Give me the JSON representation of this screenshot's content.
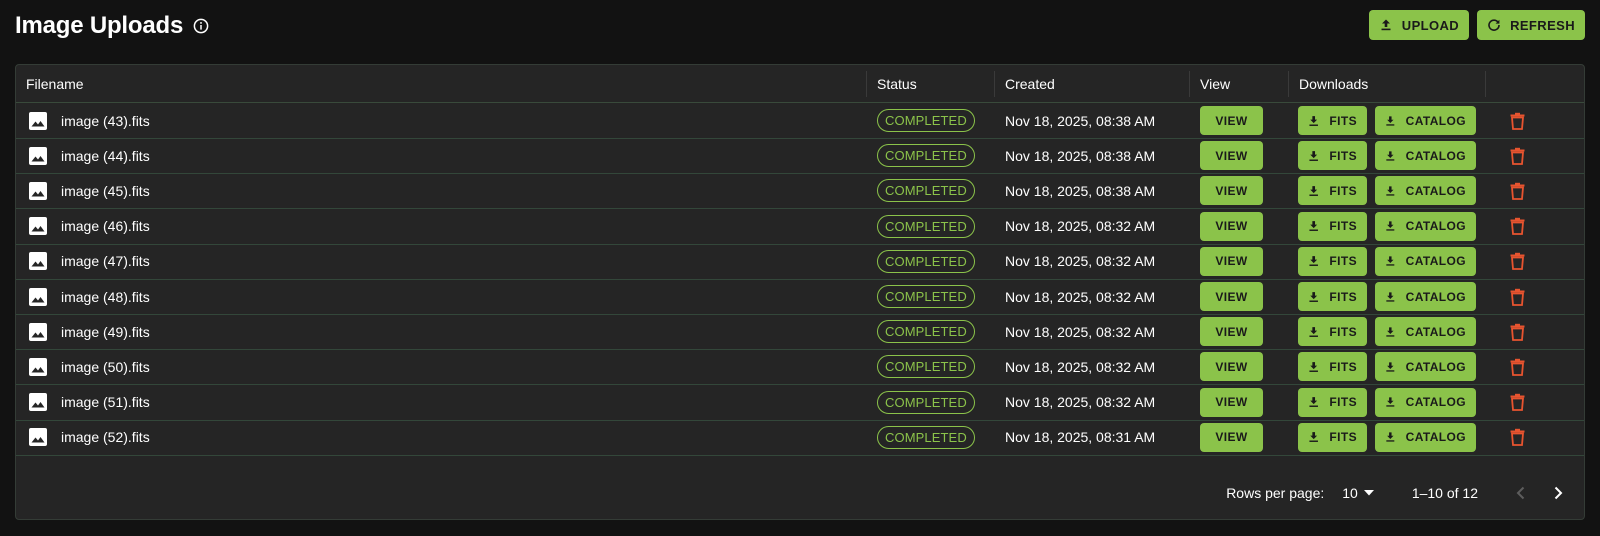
{
  "header": {
    "title": "Image Uploads",
    "upload_label": "UPLOAD",
    "refresh_label": "REFRESH"
  },
  "table": {
    "columns": {
      "filename": "Filename",
      "status": "Status",
      "created": "Created",
      "view": "View",
      "downloads": "Downloads"
    },
    "view_label": "VIEW",
    "fits_label": "FITS",
    "catalog_label": "CATALOG",
    "rows": [
      {
        "filename": "image (43).fits",
        "status": "COMPLETED",
        "created": "Nov 18, 2025, 08:38 AM"
      },
      {
        "filename": "image (44).fits",
        "status": "COMPLETED",
        "created": "Nov 18, 2025, 08:38 AM"
      },
      {
        "filename": "image (45).fits",
        "status": "COMPLETED",
        "created": "Nov 18, 2025, 08:38 AM"
      },
      {
        "filename": "image (46).fits",
        "status": "COMPLETED",
        "created": "Nov 18, 2025, 08:32 AM"
      },
      {
        "filename": "image (47).fits",
        "status": "COMPLETED",
        "created": "Nov 18, 2025, 08:32 AM"
      },
      {
        "filename": "image (48).fits",
        "status": "COMPLETED",
        "created": "Nov 18, 2025, 08:32 AM"
      },
      {
        "filename": "image (49).fits",
        "status": "COMPLETED",
        "created": "Nov 18, 2025, 08:32 AM"
      },
      {
        "filename": "image (50).fits",
        "status": "COMPLETED",
        "created": "Nov 18, 2025, 08:32 AM"
      },
      {
        "filename": "image (51).fits",
        "status": "COMPLETED",
        "created": "Nov 18, 2025, 08:32 AM"
      },
      {
        "filename": "image (52).fits",
        "status": "COMPLETED",
        "created": "Nov 18, 2025, 08:31 AM"
      }
    ]
  },
  "pagination": {
    "rows_per_page_label": "Rows per page:",
    "rows_per_page_value": "10",
    "range": "1–10 of 12"
  },
  "icons": {
    "title_info": "info-icon",
    "upload": "upload-icon",
    "refresh": "refresh-icon",
    "file": "image-icon",
    "download": "download-icon",
    "delete": "trash-icon"
  },
  "colors": {
    "accent": "#8bc34a",
    "delete": "#e8542f",
    "background": "#121212",
    "card": "#252525"
  }
}
